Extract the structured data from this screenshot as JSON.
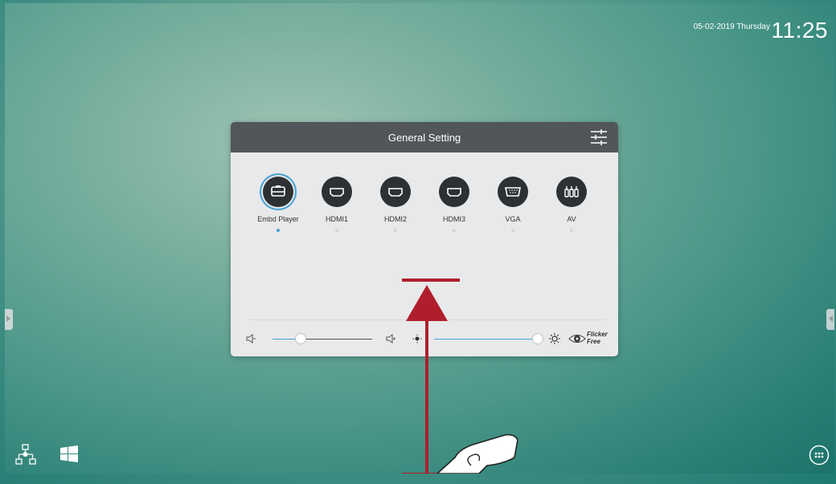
{
  "status_bar": {
    "date": "05-02-2019 Thursday",
    "time": "11:25"
  },
  "panel": {
    "title": "General Setting",
    "sources": [
      {
        "label": "Embd Player",
        "icon": "embd-player-icon",
        "active": true
      },
      {
        "label": "HDMI1",
        "icon": "hdmi-icon",
        "active": false
      },
      {
        "label": "HDMI2",
        "icon": "hdmi-icon",
        "active": false
      },
      {
        "label": "HDMI3",
        "icon": "hdmi-icon",
        "active": false
      },
      {
        "label": "VGA",
        "icon": "vga-icon",
        "active": false
      },
      {
        "label": "AV",
        "icon": "av-icon",
        "active": false
      }
    ],
    "volume": {
      "level": 0.25
    },
    "brightness": {
      "level": 1.0
    },
    "flicker_free": {
      "line1": "Flicker",
      "line2": "Free"
    }
  },
  "colors": {
    "accent": "#4aa3d8",
    "arrow": "#b01e2b",
    "panel_header": "#515659",
    "panel_body": "#e8e9ea"
  }
}
